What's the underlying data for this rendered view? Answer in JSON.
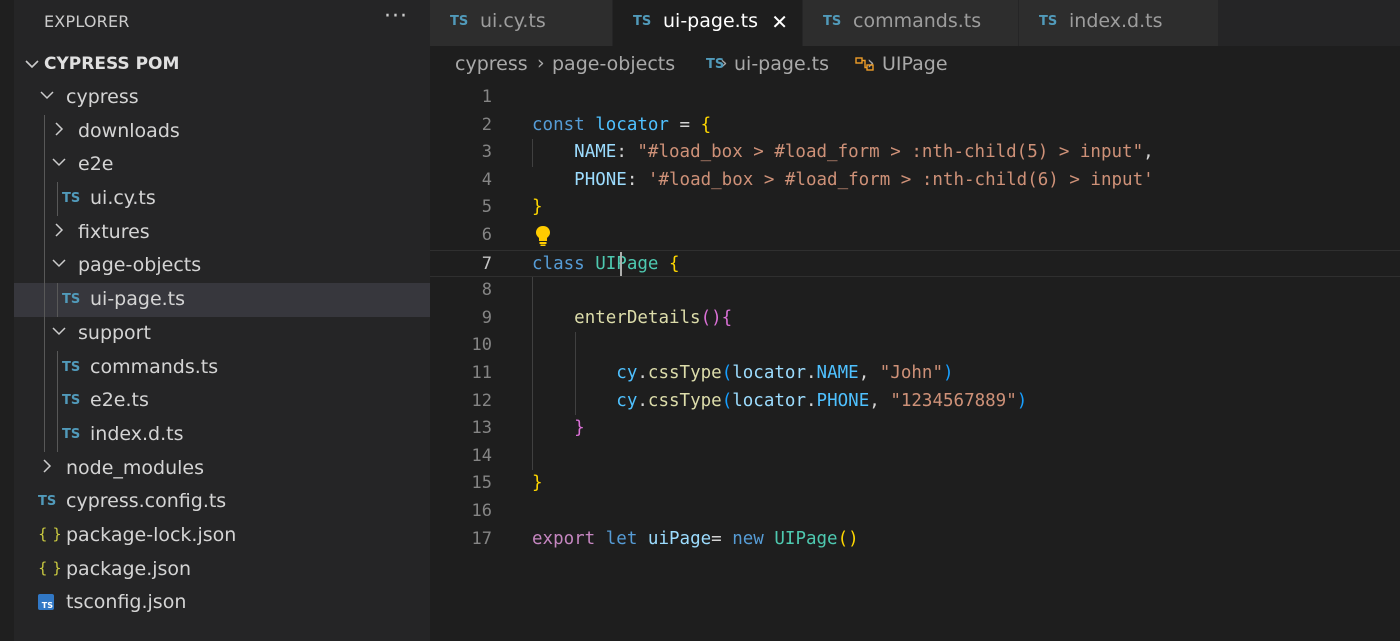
{
  "sidebar": {
    "title": "EXPLORER",
    "more_label": "···",
    "section": "CYPRESS POM",
    "tree": [
      {
        "label": "cypress",
        "type": "folder-open"
      },
      {
        "label": "downloads",
        "type": "folder"
      },
      {
        "label": "e2e",
        "type": "folder-open"
      },
      {
        "label": "ui.cy.ts",
        "type": "ts"
      },
      {
        "label": "fixtures",
        "type": "folder"
      },
      {
        "label": "page-objects",
        "type": "folder-open"
      },
      {
        "label": "ui-page.ts",
        "type": "ts",
        "selected": true
      },
      {
        "label": "support",
        "type": "folder-open"
      },
      {
        "label": "commands.ts",
        "type": "ts"
      },
      {
        "label": "e2e.ts",
        "type": "ts"
      },
      {
        "label": "index.d.ts",
        "type": "ts"
      },
      {
        "label": "node_modules",
        "type": "folder"
      },
      {
        "label": "cypress.config.ts",
        "type": "ts"
      },
      {
        "label": "package-lock.json",
        "type": "json"
      },
      {
        "label": "package.json",
        "type": "json"
      },
      {
        "label": "tsconfig.json",
        "type": "tsconfig"
      }
    ],
    "icons": {
      "ts": "TS",
      "json": "{ }",
      "tsconfig": "TS"
    }
  },
  "tabs": [
    {
      "label": "ui.cy.ts",
      "icon": "TS",
      "active": false
    },
    {
      "label": "ui-page.ts",
      "icon": "TS",
      "active": true,
      "close": "✕"
    },
    {
      "label": "commands.ts",
      "icon": "TS",
      "active": false
    },
    {
      "label": "index.d.ts",
      "icon": "TS",
      "active": false
    }
  ],
  "breadcrumb": {
    "parts": [
      "cypress",
      "page-objects",
      "ui-page.ts",
      "UIPage"
    ],
    "separator": "›",
    "ts_icon": "TS"
  },
  "editor": {
    "current_line": 7,
    "line_numbers": [
      "1",
      "2",
      "3",
      "4",
      "5",
      "6",
      "7",
      "8",
      "9",
      "10",
      "11",
      "12",
      "13",
      "14",
      "15",
      "16",
      "17"
    ],
    "lines": [
      [],
      [
        {
          "t": "const ",
          "c": "kw"
        },
        {
          "t": "locator",
          "c": "var"
        },
        {
          "t": " = ",
          "c": "pl"
        },
        {
          "t": "{",
          "c": "b1"
        }
      ],
      [
        {
          "t": "    ",
          "c": "pl"
        },
        {
          "t": "NAME",
          "c": "prop"
        },
        {
          "t": ": ",
          "c": "pl"
        },
        {
          "t": "\"#load_box > #load_form > :nth-child(5) > input\"",
          "c": "str"
        },
        {
          "t": ",",
          "c": "pl"
        }
      ],
      [
        {
          "t": "    ",
          "c": "pl"
        },
        {
          "t": "PHONE",
          "c": "prop"
        },
        {
          "t": ": ",
          "c": "pl"
        },
        {
          "t": "'#load_box > #load_form > :nth-child(6) > input'",
          "c": "str"
        }
      ],
      [
        {
          "t": "}",
          "c": "b1"
        }
      ],
      [],
      [
        {
          "t": "class ",
          "c": "kw"
        },
        {
          "t": "UIPage",
          "c": "cls"
        },
        {
          "t": " ",
          "c": "pl"
        },
        {
          "t": "{",
          "c": "b1"
        }
      ],
      [],
      [
        {
          "t": "    ",
          "c": "pl"
        },
        {
          "t": "enterDetails",
          "c": "fn"
        },
        {
          "t": "(){",
          "c": "b2"
        }
      ],
      [],
      [
        {
          "t": "        ",
          "c": "pl"
        },
        {
          "t": "cy",
          "c": "var"
        },
        {
          "t": ".",
          "c": "pl"
        },
        {
          "t": "cssType",
          "c": "fn"
        },
        {
          "t": "(",
          "c": "b3"
        },
        {
          "t": "locator",
          "c": "prop"
        },
        {
          "t": ".",
          "c": "pl"
        },
        {
          "t": "NAME",
          "c": "var"
        },
        {
          "t": ", ",
          "c": "pl"
        },
        {
          "t": "\"John\"",
          "c": "str"
        },
        {
          "t": ")",
          "c": "b3"
        }
      ],
      [
        {
          "t": "        ",
          "c": "pl"
        },
        {
          "t": "cy",
          "c": "var"
        },
        {
          "t": ".",
          "c": "pl"
        },
        {
          "t": "cssType",
          "c": "fn"
        },
        {
          "t": "(",
          "c": "b3"
        },
        {
          "t": "locator",
          "c": "prop"
        },
        {
          "t": ".",
          "c": "pl"
        },
        {
          "t": "PHONE",
          "c": "var"
        },
        {
          "t": ", ",
          "c": "pl"
        },
        {
          "t": "\"1234567889\"",
          "c": "str"
        },
        {
          "t": ")",
          "c": "b3"
        }
      ],
      [
        {
          "t": "    ",
          "c": "pl"
        },
        {
          "t": "}",
          "c": "b2"
        }
      ],
      [],
      [
        {
          "t": "}",
          "c": "b1"
        }
      ],
      [],
      [
        {
          "t": "export ",
          "c": "kwp"
        },
        {
          "t": "let ",
          "c": "kw"
        },
        {
          "t": "uiPage",
          "c": "prop"
        },
        {
          "t": "= ",
          "c": "pl"
        },
        {
          "t": "new ",
          "c": "kw"
        },
        {
          "t": "UIPage",
          "c": "cls"
        },
        {
          "t": "()",
          "c": "b1"
        }
      ]
    ]
  }
}
